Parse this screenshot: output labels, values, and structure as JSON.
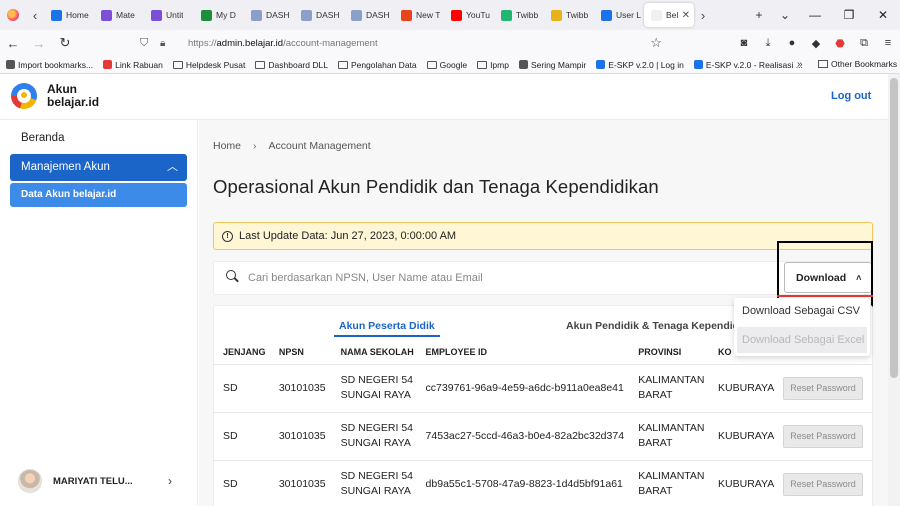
{
  "browser": {
    "tabs": [
      {
        "label": "Home",
        "color": "#1a73e8"
      },
      {
        "label": "Mate",
        "color": "#7b4fd6"
      },
      {
        "label": "Untit",
        "color": "#7b4fd6"
      },
      {
        "label": "My D",
        "color": "#1e8e3e"
      },
      {
        "label": "DASH",
        "color": "#8aa0c8"
      },
      {
        "label": "DASH",
        "color": "#8aa0c8"
      },
      {
        "label": "DASH",
        "color": "#8aa0c8"
      },
      {
        "label": "New T",
        "color": "#e8431b"
      },
      {
        "label": "YouTu",
        "color": "#ff0000"
      },
      {
        "label": "Twibb",
        "color": "#22b573"
      },
      {
        "label": "Twibb",
        "color": "#e8b21b"
      },
      {
        "label": "User L",
        "color": "#1a73e8"
      },
      {
        "label": "Bel",
        "color": "#f0f0f0"
      }
    ],
    "url_scheme": "https://",
    "url_host": "admin.belajar.id",
    "url_path": "/account-management",
    "bookmarks": [
      {
        "label": "Import bookmarks...",
        "icon": "import-icon",
        "color": "#555"
      },
      {
        "label": "Link Rabuan",
        "icon": "s-icon",
        "color": "#e53935"
      },
      {
        "label": "Helpdesk Pusat",
        "icon": "folder-icon",
        "color": ""
      },
      {
        "label": "Dashboard DLL",
        "icon": "folder-icon",
        "color": ""
      },
      {
        "label": "Pengolahan Data",
        "icon": "folder-icon",
        "color": ""
      },
      {
        "label": "Google",
        "icon": "folder-icon",
        "color": ""
      },
      {
        "label": "Ipmp",
        "icon": "folder-icon",
        "color": ""
      },
      {
        "label": "Sering Mampir",
        "icon": "gear-icon",
        "color": "#555"
      },
      {
        "label": "E-SKP v.2.0 | Log in",
        "icon": "globe-icon",
        "color": "#1a73e8"
      },
      {
        "label": "E-SKP v.2.0 - Realisasi ...",
        "icon": "globe-icon",
        "color": "#1a73e8"
      }
    ],
    "bookmark_other": "Other Bookmarks"
  },
  "header": {
    "brand_line1": "Akun",
    "brand_line2": "belajar.id",
    "logout_label": "Log out"
  },
  "sidebar": {
    "home_label": "Beranda",
    "group_label": "Manajemen Akun",
    "sub_label": "Data Akun belajar.id",
    "user_name": "MARIYATI TELU..."
  },
  "main": {
    "breadcrumb_home": "Home",
    "breadcrumb_current": "Account Management",
    "title": "Operasional Akun Pendidik dan Tenaga Kependidikan",
    "alert_text": "Last Update Data: Jun 27, 2023, 0:00:00 AM",
    "search_placeholder": "Cari berdasarkan NPSN, User Name atau Email",
    "download_label": "Download",
    "download_menu": [
      "Download Sebagai CSV",
      "Download Sebagai Excel"
    ],
    "tabs": [
      "Akun Peserta Didik",
      "Akun Pendidik & Tenaga Kependidik"
    ],
    "columns": [
      "JENJANG",
      "NPSN",
      "NAMA SEKOLAH",
      "EMPLOYEE ID",
      "PROVINSI",
      "KO"
    ],
    "rows": [
      {
        "jenjang": "SD",
        "npsn": "30101035",
        "sekolah": "SD NEGERI 54 SUNGAI RAYA",
        "employee_id": "cc739761-96a9-4e59-a6dc-b911a0ea8e41",
        "provinsi": "KALIMANTAN BARAT",
        "kota": "KUBURAYA",
        "action": "Reset Password"
      },
      {
        "jenjang": "SD",
        "npsn": "30101035",
        "sekolah": "SD NEGERI 54 SUNGAI RAYA",
        "employee_id": "7453ac27-5ccd-46a3-b0e4-82a2bc32d374",
        "provinsi": "KALIMANTAN BARAT",
        "kota": "KUBURAYA",
        "action": "Reset Password"
      },
      {
        "jenjang": "SD",
        "npsn": "30101035",
        "sekolah": "SD NEGERI 54 SUNGAI RAYA",
        "employee_id": "db9a55c1-5708-47a9-8823-1d4d5bf91a61",
        "provinsi": "KALIMANTAN BARAT",
        "kota": "KUBURAYA",
        "action": "Reset Password"
      }
    ]
  },
  "colors": {
    "primary": "#1b64c8",
    "sub_active": "#3d8be8",
    "alert_bg": "#fff6d6",
    "alert_border": "#f0c55a",
    "annotation_box": "#000000",
    "annotation_line": "#e53935"
  }
}
